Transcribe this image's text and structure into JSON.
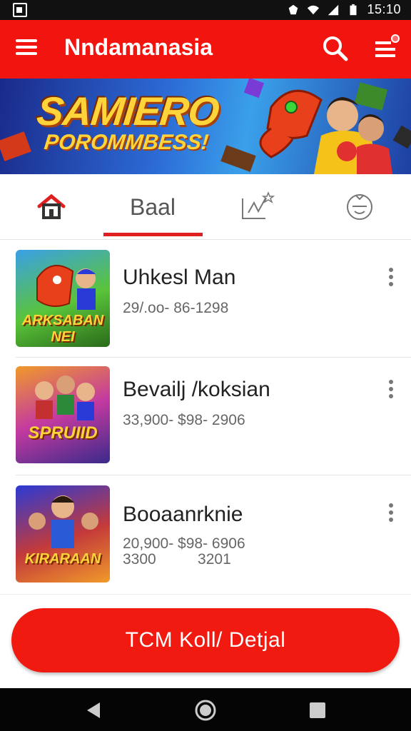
{
  "status_bar": {
    "time": "15:10",
    "icons": [
      "gallery-icon",
      "data-saver-icon",
      "wifi-icon",
      "signal-icon",
      "battery-icon"
    ]
  },
  "app_bar": {
    "title": "Nndamanasia",
    "icons": [
      "menu-icon",
      "search-icon",
      "list-menu-icon"
    ],
    "color": "#f2150f"
  },
  "banner": {
    "line1": "SAMIERO",
    "line2": "POROMMBESS!"
  },
  "tabs": [
    {
      "icon": "home-icon",
      "label": ""
    },
    {
      "icon": "",
      "label": "Baal",
      "active": true
    },
    {
      "icon": "chart-icon",
      "label": ""
    },
    {
      "icon": "smiley-icon",
      "label": ""
    }
  ],
  "items": [
    {
      "title": "Uhkesl Man",
      "meta1": "29/.oo- 86-1298",
      "meta2": "",
      "thumb_text": "ARKSABAN NEI"
    },
    {
      "title": "Bevailj /koksian",
      "meta1": "33,900- $98- 2906",
      "meta2": "",
      "thumb_text": "SPRUIID"
    },
    {
      "title": "Booaanrknie",
      "meta1": "20,900- $98- 6906",
      "meta2": "3300          3201",
      "thumb_text": "KIRARAAN"
    }
  ],
  "cta": {
    "label": "TCM Koll/ Detjal",
    "color": "#f01a10"
  },
  "nav": {
    "icons": [
      "back-icon",
      "home-circle-icon",
      "recents-icon"
    ]
  }
}
